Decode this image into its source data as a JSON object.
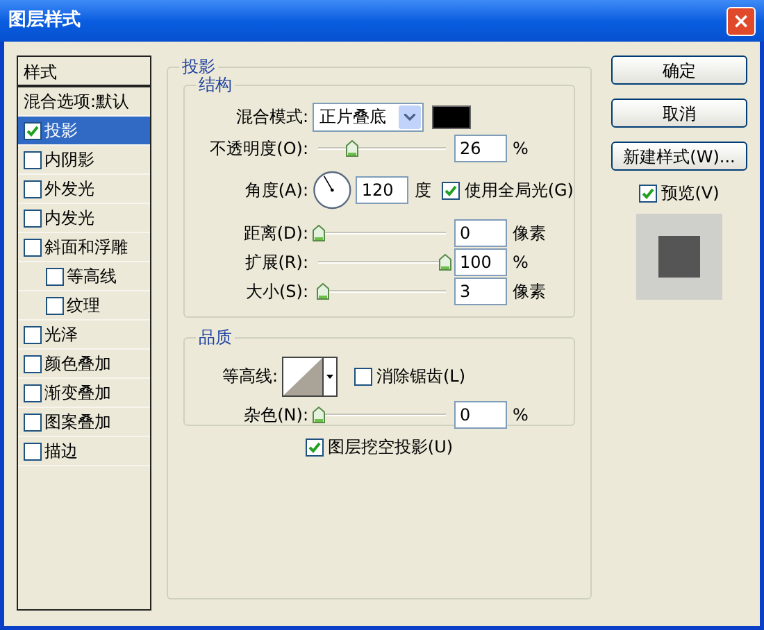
{
  "window": {
    "title": "图层样式",
    "close": "×"
  },
  "styles_panel": {
    "header": "样式",
    "items": [
      {
        "label": "混合选项:默认",
        "kind": "plain",
        "selected": false
      },
      {
        "label": "投影",
        "kind": "check",
        "checked": true,
        "selected": true
      },
      {
        "label": "内阴影",
        "kind": "check",
        "checked": false,
        "selected": false
      },
      {
        "label": "外发光",
        "kind": "check",
        "checked": false,
        "selected": false
      },
      {
        "label": "内发光",
        "kind": "check",
        "checked": false,
        "selected": false
      },
      {
        "label": "斜面和浮雕",
        "kind": "check",
        "checked": false,
        "selected": false,
        "children": [
          {
            "label": "等高线",
            "kind": "check",
            "checked": false,
            "selected": false
          },
          {
            "label": "纹理",
            "kind": "check",
            "checked": false,
            "selected": false
          }
        ]
      },
      {
        "label": "光泽",
        "kind": "check",
        "checked": false,
        "selected": false
      },
      {
        "label": "颜色叠加",
        "kind": "check",
        "checked": false,
        "selected": false
      },
      {
        "label": "渐变叠加",
        "kind": "check",
        "checked": false,
        "selected": false
      },
      {
        "label": "图案叠加",
        "kind": "check",
        "checked": false,
        "selected": false
      },
      {
        "label": "描边",
        "kind": "check",
        "checked": false,
        "selected": false
      }
    ]
  },
  "drop_shadow": {
    "title": "投影",
    "structure": {
      "title": "结构",
      "blend_mode": {
        "label": "混合模式:",
        "value": "正片叠底",
        "color": "#000000"
      },
      "opacity": {
        "label": "不透明度(O):",
        "level": 0.26,
        "value": "26",
        "unit": "%"
      },
      "angle": {
        "label": "角度(A):",
        "value": "120",
        "unit": "度",
        "global_light": {
          "label": "使用全局光(G)",
          "checked": true
        }
      },
      "distance": {
        "label": "距离(D):",
        "level": 0,
        "value": "0",
        "unit": "像素"
      },
      "spread": {
        "label": "扩展(R):",
        "level": 1,
        "value": "100",
        "unit": "%"
      },
      "size": {
        "label": "大小(S):",
        "level": 0.03,
        "value": "3",
        "unit": "像素"
      }
    },
    "quality": {
      "title": "品质",
      "contour": {
        "label": "等高线:",
        "anti_aliased": {
          "label": "消除锯齿(L)",
          "checked": false
        }
      },
      "noise": {
        "label": "杂色(N):",
        "level": 0,
        "value": "0",
        "unit": "%"
      }
    },
    "knockout": {
      "label": "图层挖空投影(U)",
      "checked": true
    }
  },
  "buttons": [
    "确定",
    "取消",
    "新建样式(W)..."
  ],
  "preview": {
    "label": "预览(V)",
    "checked": true
  }
}
